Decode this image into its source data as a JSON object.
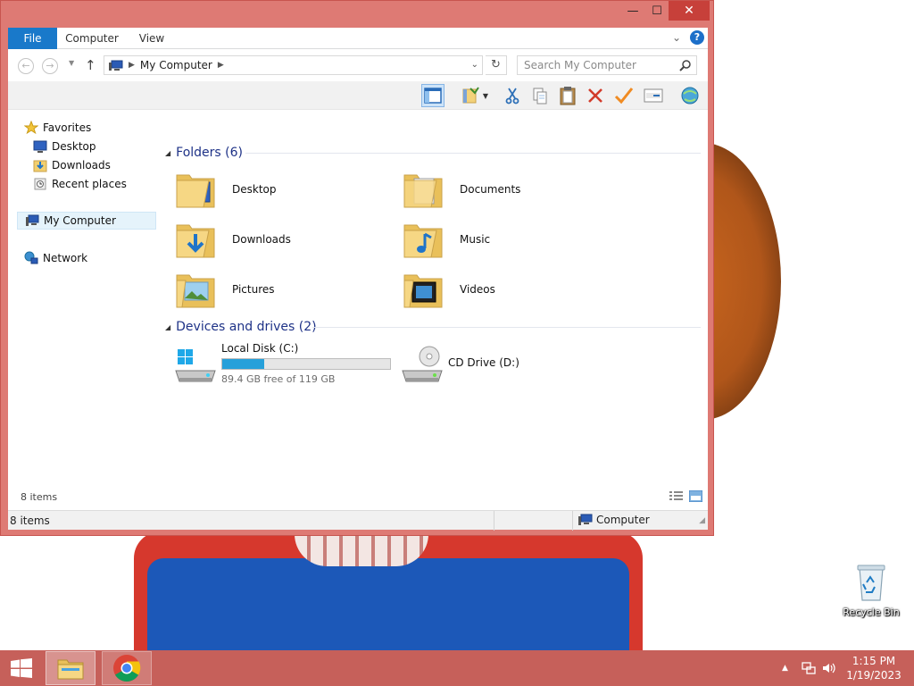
{
  "window": {
    "controls": {
      "minimize": "—",
      "maximize": "☐",
      "close": "✕"
    }
  },
  "ribbon": {
    "tabs": [
      "File",
      "Computer",
      "View"
    ],
    "collapse_icon": "chevron-down-icon",
    "help_label": "?"
  },
  "address": {
    "location": "My Computer",
    "search_placeholder": "Search My Computer"
  },
  "toolbar": {
    "buttons": [
      "layout-pane",
      "properties",
      "cut",
      "copy",
      "paste",
      "delete",
      "rename-check",
      "open-window",
      "network-globe"
    ]
  },
  "nav_pane": {
    "favorites": "Favorites",
    "favorite_items": [
      "Desktop",
      "Downloads",
      "Recent places"
    ],
    "computer": "My Computer",
    "network": "Network"
  },
  "content": {
    "folders_header": "Folders (6)",
    "folders": [
      "Desktop",
      "Documents",
      "Downloads",
      "Music",
      "Pictures",
      "Videos"
    ],
    "drives_header": "Devices and drives (2)",
    "drives": [
      {
        "name": "Local Disk (C:)",
        "free": "89.4 GB free of 119 GB",
        "used_fraction": 0.25
      },
      {
        "name": "CD Drive (D:)"
      }
    ]
  },
  "status": {
    "item_count": "8 items",
    "bottom_item_count": "8 items",
    "location": "Computer"
  },
  "desktop": {
    "recycle_bin": "Recycle Bin"
  },
  "taskbar": {
    "time": "1:15 PM",
    "date": "1/19/2023"
  },
  "colors": {
    "window_border": "#de7a74",
    "taskbar": "#c6605a",
    "file_tab": "#1979ca",
    "group_header": "#1e3287",
    "drive_bar": "#26a0da",
    "close_button": "#c7403a"
  }
}
